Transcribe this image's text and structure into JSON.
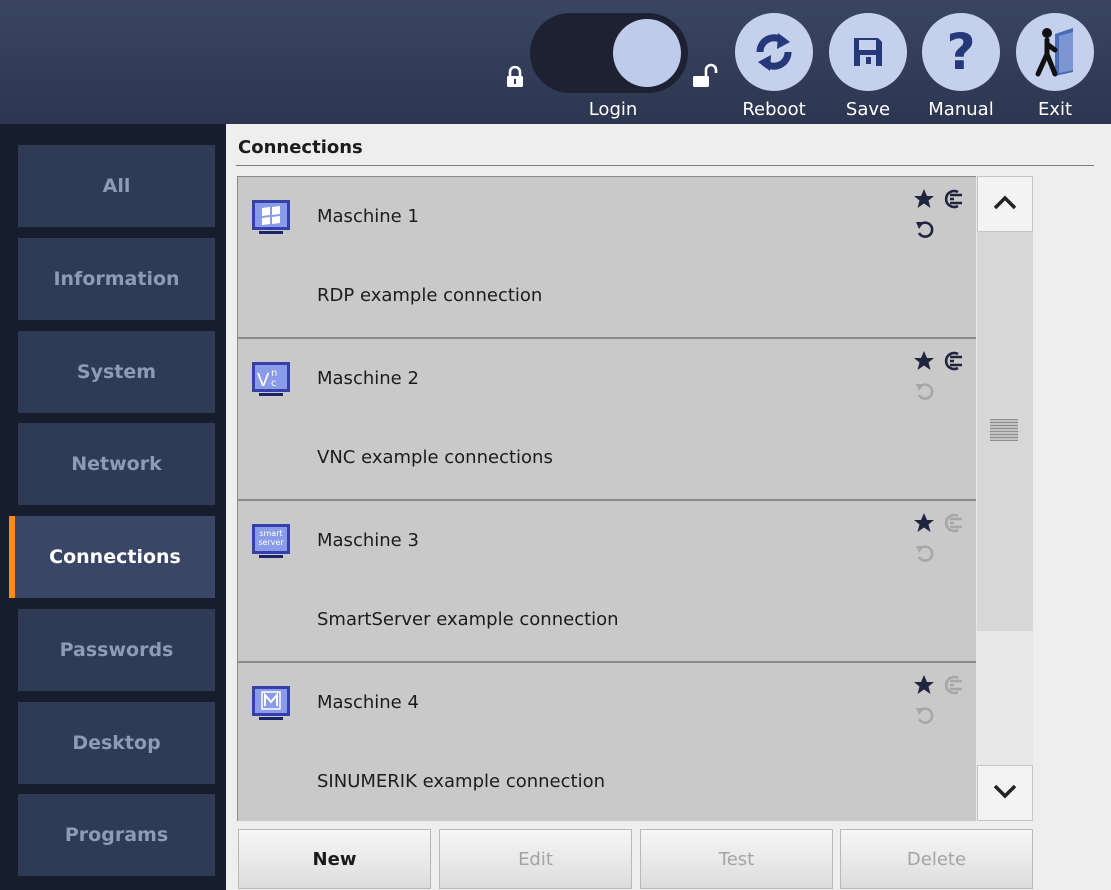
{
  "topbar": {
    "login_label": "Login",
    "reboot_label": "Reboot",
    "save_label": "Save",
    "manual_label": "Manual",
    "exit_label": "Exit",
    "icons": {
      "locked": "padlock-closed-icon",
      "unlocked": "padlock-open-icon",
      "reboot": "refresh-icon",
      "save": "floppy-disk-icon",
      "manual": "question-mark-icon",
      "exit": "exit-door-icon"
    }
  },
  "sidebar": {
    "active_accent": "#ff8b1a",
    "items": [
      {
        "label": "All"
      },
      {
        "label": "Information"
      },
      {
        "label": "System"
      },
      {
        "label": "Network"
      },
      {
        "label": "Connections",
        "active": true
      },
      {
        "label": "Passwords"
      },
      {
        "label": "Desktop"
      },
      {
        "label": "Programs"
      }
    ]
  },
  "main": {
    "title": "Connections",
    "connections": [
      {
        "name": "Maschine 1",
        "description": "RDP example connection",
        "icon": "monitor-windows-icon",
        "autostart_enabled": true,
        "reconnect_enabled": true
      },
      {
        "name": "Maschine 2",
        "description": "VNC example connections",
        "icon": "monitor-vnc-icon",
        "autostart_enabled": true,
        "reconnect_enabled": false
      },
      {
        "name": "Maschine 3",
        "description": "SmartServer example connection",
        "icon": "monitor-smartserver-icon",
        "autostart_enabled": false,
        "reconnect_enabled": false,
        "icon_text": [
          "smart",
          "server"
        ]
      },
      {
        "name": "Maschine 4",
        "description": "SINUMERIK example connection",
        "icon": "monitor-sinumerik-icon",
        "autostart_enabled": false,
        "reconnect_enabled": false
      }
    ],
    "buttons": {
      "new": "New",
      "edit": "Edit",
      "test": "Test",
      "delete": "Delete"
    }
  }
}
